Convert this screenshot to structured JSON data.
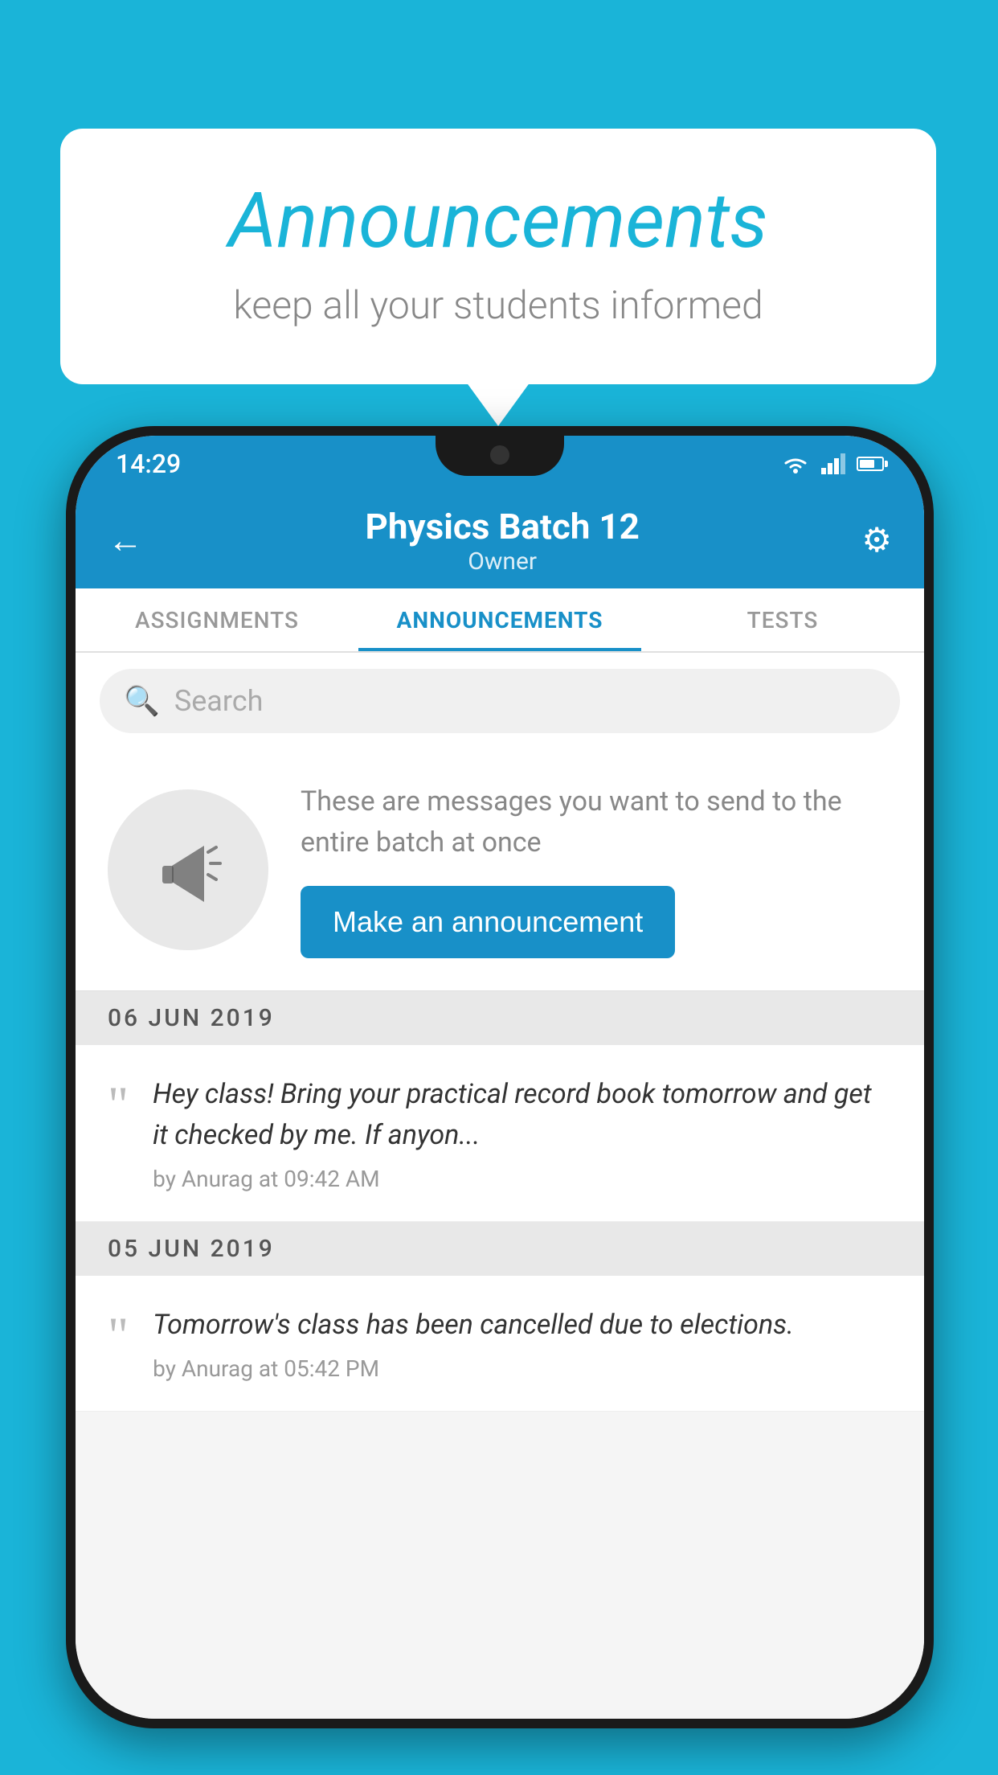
{
  "background": {
    "color": "#1ab4d8"
  },
  "speech_bubble": {
    "title": "Announcements",
    "subtitle": "keep all your students informed"
  },
  "phone": {
    "status_bar": {
      "time": "14:29",
      "wifi": "wifi",
      "signal": "signal",
      "battery": "battery"
    },
    "header": {
      "back_icon": "←",
      "title": "Physics Batch 12",
      "subtitle": "Owner",
      "gear_icon": "⚙"
    },
    "tabs": [
      {
        "label": "ASSIGNMENTS",
        "active": false
      },
      {
        "label": "ANNOUNCEMENTS",
        "active": true
      },
      {
        "label": "TESTS",
        "active": false
      }
    ],
    "search": {
      "placeholder": "Search"
    },
    "promo": {
      "text": "These are messages you want to send to the entire batch at once",
      "button_label": "Make an announcement"
    },
    "announcements": [
      {
        "date": "06  JUN  2019",
        "message": "Hey class! Bring your practical record book tomorrow and get it checked by me. If anyon...",
        "meta": "by Anurag at 09:42 AM"
      },
      {
        "date": "05  JUN  2019",
        "message": "Tomorrow's class has been cancelled due to elections.",
        "meta": "by Anurag at 05:42 PM"
      }
    ]
  }
}
